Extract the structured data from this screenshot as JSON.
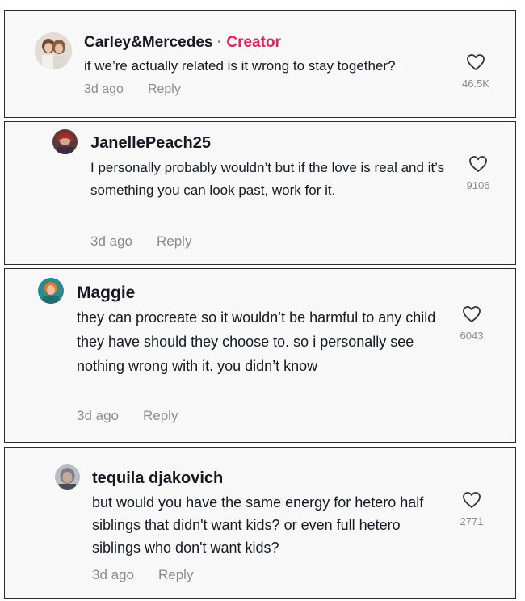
{
  "comments": [
    {
      "username": "Carley&Mercedes",
      "separator": "·",
      "badge": "Creator",
      "text": "if we’re actually related is it wrong to stay together?",
      "time": "3d ago",
      "reply": "Reply",
      "likes": "46.5K"
    },
    {
      "username": "JanellePeach25",
      "text": "I personally probably wouldn’t but if the love is real and it’s something you can look past, work for it.",
      "time": "3d ago",
      "reply": "Reply",
      "likes": "9106"
    },
    {
      "username": "Maggie",
      "text": "they can procreate so it wouldn’t be harmful to any child they have should they choose to. so i personally see nothing wrong with it. you didn’t know",
      "time": "3d ago",
      "reply": "Reply",
      "likes": "6043"
    },
    {
      "username": "tequila djakovich",
      "text": "but would you have the same energy for hetero half siblings that didn't want kids? or even full hetero siblings who don't want kids?",
      "time": "3d ago",
      "reply": "Reply",
      "likes": "2771"
    }
  ],
  "colors": {
    "creator_badge": "#e0245e",
    "muted": "#8a8b91",
    "card_bg": "#f8f8f8"
  },
  "icons": {
    "like": "heart-outline-icon"
  }
}
